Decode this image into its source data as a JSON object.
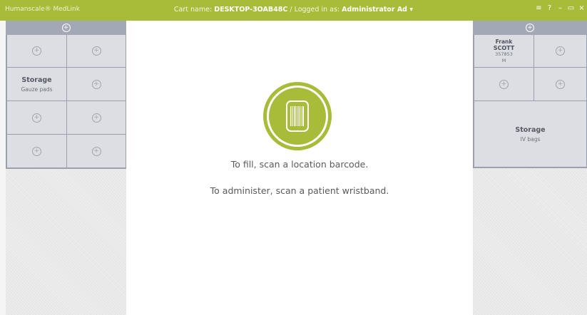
{
  "titlebar": {
    "app_name": "Humanscale® MedLink",
    "cart_label": "Cart name:",
    "cart_name": "DESKTOP-3OAB48C",
    "separator": "/",
    "logged_label": "Logged in as:",
    "user": "Administrator Ad",
    "user_caret": "▾",
    "menu_icon": "≡",
    "help_icon": "?",
    "minimize_icon": "–",
    "restore_icon": "▭",
    "close_icon": "×"
  },
  "left_panel": {
    "header_plus": "+",
    "storage_title": "Storage",
    "storage_sub": "Gauze pads",
    "plus": "+"
  },
  "right_panel": {
    "header_plus": "+",
    "patient": {
      "first": "Frank",
      "last": "SCOTT",
      "id": "357853",
      "sex": "M"
    },
    "storage_title": "Storage",
    "storage_sub": "IV bags",
    "plus": "+"
  },
  "main": {
    "fill_message": "To fill, scan a location barcode.",
    "administer_message": "To administer, scan a patient wristband."
  },
  "colors": {
    "accent": "#a9bc3a",
    "panel_header": "#a3a8b6",
    "cell": "#dcdee3"
  }
}
